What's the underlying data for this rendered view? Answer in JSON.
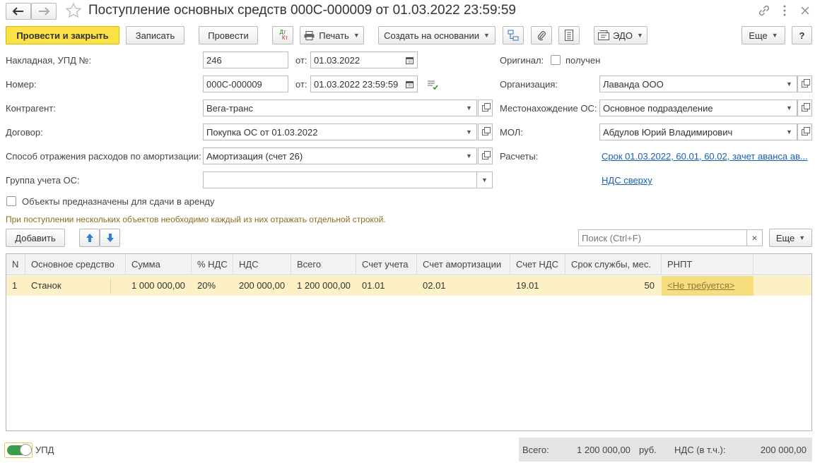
{
  "window": {
    "title": "Поступление основных средств 000С-000009 от 01.03.2022 23:59:59"
  },
  "toolbar": {
    "post_and_close": "Провести и закрыть",
    "save": "Записать",
    "post": "Провести",
    "dt_top": "Дт",
    "dt_bottom": "Кт",
    "print": "Печать",
    "create_based_on": "Создать на основании",
    "edo": "ЭДО",
    "more": "Еще",
    "help": "?"
  },
  "form": {
    "invoice_label": "Накладная, УПД №:",
    "invoice_value": "246",
    "invoice_date_label": "от:",
    "invoice_date": "01.03.2022",
    "original_label": "Оригинал:",
    "original_received_label": "получен",
    "number_label": "Номер:",
    "number_value": "000С-000009",
    "number_date_label": "от:",
    "number_date": "01.03.2022 23:59:59",
    "organization_label": "Организация:",
    "organization_value": "Лаванда ООО",
    "counterparty_label": "Контрагент:",
    "counterparty_value": "Вега-транс",
    "location_label": "Местонахождение ОС:",
    "location_value": "Основное подразделение",
    "contract_label": "Договор:",
    "contract_value": "Покупка ОС от 01.03.2022",
    "mol_label": "МОЛ:",
    "mol_value": "Абдулов Юрий Владимирович",
    "depreciation_label": "Способ отражения расходов по амортизации:",
    "depreciation_value": "Амортизация (счет 26)",
    "settlements_label": "Расчеты:",
    "settlements_link": "Срок 01.03.2022, 60.01, 60.02, зачет аванса ав...",
    "group_label": "Группа учета ОС:",
    "group_value": "",
    "vat_link": "НДС сверху",
    "rent_label": "Объекты предназначены для сдачи в аренду",
    "hint": "При поступлении нескольких объектов необходимо каждый из них отражать отдельной строкой."
  },
  "table_toolbar": {
    "add": "Добавить",
    "search_placeholder": "Поиск (Ctrl+F)",
    "clear": "×",
    "more": "Еще"
  },
  "table": {
    "columns": [
      "N",
      "Основное средство",
      "Сумма",
      "% НДС",
      "НДС",
      "Всего",
      "Счет учета",
      "Счет амортизации",
      "Счет НДС",
      "Срок службы, мес.",
      "РНПТ"
    ],
    "rows": [
      {
        "n": "1",
        "asset": "Станок",
        "sum": "1 000 000,00",
        "vat_rate": "20%",
        "vat": "200 000,00",
        "total": "1 200 000,00",
        "account": "01.01",
        "depr_account": "02.01",
        "vat_account": "19.01",
        "life": "50",
        "rnpt": "<Не требуется>"
      }
    ]
  },
  "footer": {
    "upd_label": "УПД",
    "total_label": "Всего:",
    "total_value": "1 200 000,00",
    "currency": "руб.",
    "vat_label": "НДС (в т.ч.):",
    "vat_value": "200 000,00"
  },
  "colors": {
    "primary_button": "#fbe046",
    "selected_row": "#fbf1c4",
    "link": "#1a5fb4",
    "toggle": "#3a9d4a"
  }
}
